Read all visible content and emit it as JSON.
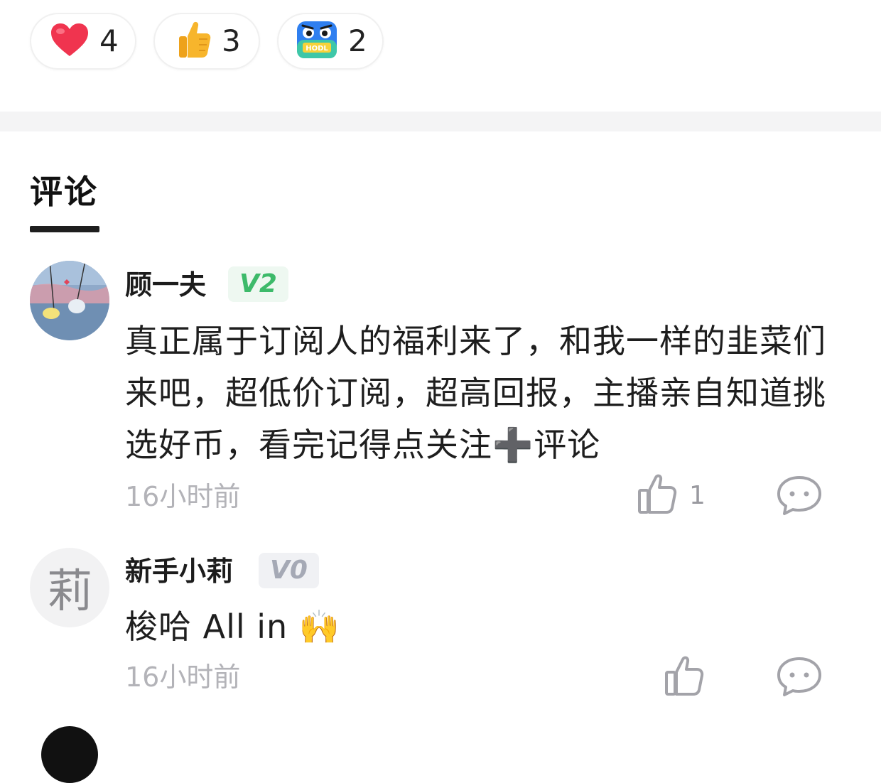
{
  "reactions": [
    {
      "icon": "heart-icon",
      "count": "4"
    },
    {
      "icon": "thumbs-up-icon",
      "count": "3"
    },
    {
      "icon": "hodl-icon",
      "count": "2",
      "icon_text": "HODL"
    }
  ],
  "tabs": {
    "comments_label": "评论"
  },
  "comments": [
    {
      "author": "顾一夫",
      "level": "V2",
      "text": "真正属于订阅人的福利来了，和我一样的韭菜们来吧，超低价订阅，超高回报，主播亲自知道挑选好币，看完记得点关注➕评论",
      "time": "16小时前",
      "likes": "1"
    },
    {
      "author": "新手小莉",
      "avatar_letter": "莉",
      "level": "V0",
      "text": "梭哈 All in 🙌",
      "time": "16小时前",
      "likes": ""
    }
  ],
  "colors": {
    "heart": "#f0344f",
    "level_v2": "#3dba6a",
    "level_v0": "#a5a9b5",
    "muted_text": "#b3b3b8"
  }
}
